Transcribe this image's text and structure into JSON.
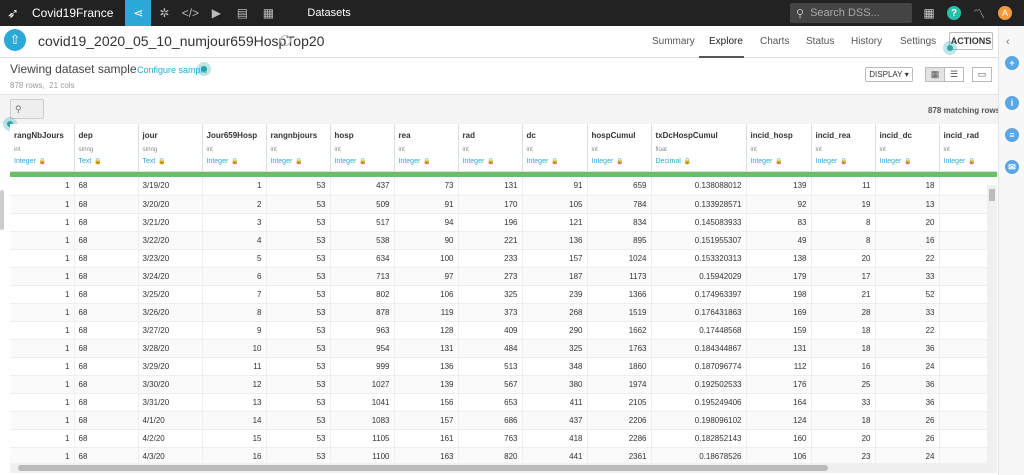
{
  "topbar": {
    "project_name": "Covid19France",
    "crumb": "Datasets",
    "search_placeholder": "Search DSS...",
    "avatar_letter": "A",
    "help_char": "?",
    "nav_icons": [
      "flow-icon",
      "settings-gear-icon",
      "code-icon",
      "run-icon",
      "notebook-icon",
      "dashboard-icon"
    ]
  },
  "header": {
    "dataset_name": "covid19_2020_05_10_numjour659HospTop20",
    "tabs": [
      "Summary",
      "Explore",
      "Charts",
      "Status",
      "History",
      "Settings"
    ],
    "active_tab": "Explore",
    "actions_label": "ACTIONS"
  },
  "subheader": {
    "viewing_label": "Viewing dataset sample",
    "configure_label": "Configure sample",
    "rows_count": "878",
    "rows_label": "rows,",
    "cols_count": "21",
    "cols_label": "cols",
    "display_label": "DISPLAY",
    "matching_label": "878 matching rows"
  },
  "columns": [
    {
      "name": "rangNbJours",
      "type": "int",
      "meaning": "Integer"
    },
    {
      "name": "dep",
      "type": "string",
      "meaning": "Text"
    },
    {
      "name": "jour",
      "type": "string",
      "meaning": "Text"
    },
    {
      "name": "Jour659Hosp",
      "type": "int",
      "meaning": "Integer"
    },
    {
      "name": "rangnbjours",
      "type": "int",
      "meaning": "Integer"
    },
    {
      "name": "hosp",
      "type": "int",
      "meaning": "Integer"
    },
    {
      "name": "rea",
      "type": "int",
      "meaning": "Integer"
    },
    {
      "name": "rad",
      "type": "int",
      "meaning": "Integer"
    },
    {
      "name": "dc",
      "type": "int",
      "meaning": "Integer"
    },
    {
      "name": "hospCumul",
      "type": "int",
      "meaning": "Integer"
    },
    {
      "name": "txDcHospCumul",
      "type": "float",
      "meaning": "Decimal"
    },
    {
      "name": "incid_hosp",
      "type": "int",
      "meaning": "Integer"
    },
    {
      "name": "incid_rea",
      "type": "int",
      "meaning": "Integer"
    },
    {
      "name": "incid_dc",
      "type": "int",
      "meaning": "Integer"
    },
    {
      "name": "incid_rad",
      "type": "int",
      "meaning": "Integer"
    }
  ],
  "rows": [
    [
      "1",
      "68",
      "3/19/20",
      "1",
      "53",
      "437",
      "73",
      "131",
      "91",
      "659",
      "0.138088012",
      "139",
      "11",
      "18",
      ""
    ],
    [
      "1",
      "68",
      "3/20/20",
      "2",
      "53",
      "509",
      "91",
      "170",
      "105",
      "784",
      "0.133928571",
      "92",
      "19",
      "13",
      ""
    ],
    [
      "1",
      "68",
      "3/21/20",
      "3",
      "53",
      "517",
      "94",
      "196",
      "121",
      "834",
      "0.145083933",
      "83",
      "8",
      "20",
      ""
    ],
    [
      "1",
      "68",
      "3/22/20",
      "4",
      "53",
      "538",
      "90",
      "221",
      "136",
      "895",
      "0.151955307",
      "49",
      "8",
      "16",
      ""
    ],
    [
      "1",
      "68",
      "3/23/20",
      "5",
      "53",
      "634",
      "100",
      "233",
      "157",
      "1024",
      "0.153320313",
      "138",
      "20",
      "22",
      ""
    ],
    [
      "1",
      "68",
      "3/24/20",
      "6",
      "53",
      "713",
      "97",
      "273",
      "187",
      "1173",
      "0.15942029",
      "179",
      "17",
      "33",
      ""
    ],
    [
      "1",
      "68",
      "3/25/20",
      "7",
      "53",
      "802",
      "106",
      "325",
      "239",
      "1366",
      "0.174963397",
      "198",
      "21",
      "52",
      ""
    ],
    [
      "1",
      "68",
      "3/26/20",
      "8",
      "53",
      "878",
      "119",
      "373",
      "268",
      "1519",
      "0.176431863",
      "169",
      "28",
      "33",
      ""
    ],
    [
      "1",
      "68",
      "3/27/20",
      "9",
      "53",
      "963",
      "128",
      "409",
      "290",
      "1662",
      "0.17448568",
      "159",
      "18",
      "22",
      ""
    ],
    [
      "1",
      "68",
      "3/28/20",
      "10",
      "53",
      "954",
      "131",
      "484",
      "325",
      "1763",
      "0.184344867",
      "131",
      "18",
      "36",
      ""
    ],
    [
      "1",
      "68",
      "3/29/20",
      "11",
      "53",
      "999",
      "136",
      "513",
      "348",
      "1860",
      "0.187096774",
      "112",
      "16",
      "24",
      ""
    ],
    [
      "1",
      "68",
      "3/30/20",
      "12",
      "53",
      "1027",
      "139",
      "567",
      "380",
      "1974",
      "0.192502533",
      "176",
      "25",
      "36",
      ""
    ],
    [
      "1",
      "68",
      "3/31/20",
      "13",
      "53",
      "1041",
      "156",
      "653",
      "411",
      "2105",
      "0.195249406",
      "164",
      "33",
      "36",
      ""
    ],
    [
      "1",
      "68",
      "4/1/20",
      "14",
      "53",
      "1083",
      "157",
      "686",
      "437",
      "2206",
      "0.198096102",
      "124",
      "18",
      "26",
      ""
    ],
    [
      "1",
      "68",
      "4/2/20",
      "15",
      "53",
      "1105",
      "161",
      "763",
      "418",
      "2286",
      "0.182852143",
      "160",
      "20",
      "26",
      ""
    ],
    [
      "1",
      "68",
      "4/3/20",
      "16",
      "53",
      "1100",
      "163",
      "820",
      "441",
      "2361",
      "0.18678526",
      "106",
      "23",
      "24",
      ""
    ],
    [
      "1",
      "68",
      "4/4/20",
      "17",
      "53",
      "1024",
      "150",
      "891",
      "458",
      "2373",
      "0.193004635",
      "31",
      "8",
      "17",
      ""
    ]
  ]
}
